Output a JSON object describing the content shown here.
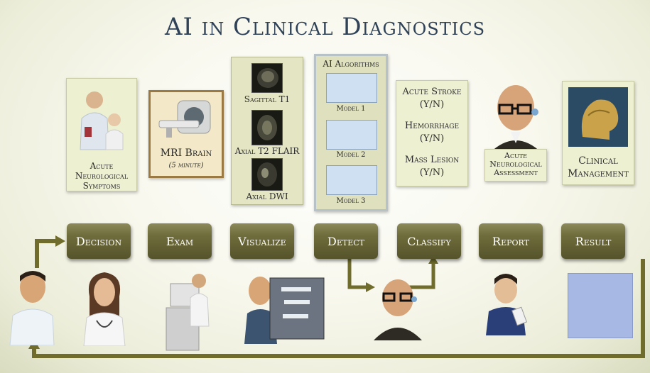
{
  "title": "AI in Clinical Diagnostics",
  "top_cards": {
    "symptoms": {
      "line1": "Acute",
      "line2": "Neurological",
      "line3": "Symptoms"
    },
    "mri": {
      "line1": "MRI Brain",
      "line2": "(5 minute)"
    },
    "sequences": [
      "Sagittal T1",
      "Axial T2 FLAIR",
      "Axial DWI"
    ],
    "algorithms": {
      "header": "AI Algorithms",
      "models": [
        "Model 1",
        "Model 2",
        "Model 3"
      ]
    },
    "classification": [
      {
        "label": "Acute Stroke",
        "yn": "(Y/N)"
      },
      {
        "label": "Hemorrhage",
        "yn": "(Y/N)"
      },
      {
        "label": "Mass Lesion",
        "yn": "(Y/N)"
      }
    ],
    "assessment": {
      "line1": "Acute",
      "line2": "Neurological",
      "line3": "Assessment"
    },
    "management": {
      "line1": "Clinical",
      "line2": "Management"
    }
  },
  "steps": [
    "Decision",
    "Exam",
    "Visualize",
    "Detect",
    "Classify",
    "Report",
    "Result"
  ],
  "colors": {
    "title": "#2f4258",
    "button": "#6f6c3c",
    "arrow": "#6f6c2c",
    "result_box": "#a8b8e4"
  },
  "icons": [
    "patient-icon",
    "doctor-icon",
    "mri-scanner-icon",
    "radiologist-icon",
    "ai-head-icon",
    "reporter-icon"
  ]
}
